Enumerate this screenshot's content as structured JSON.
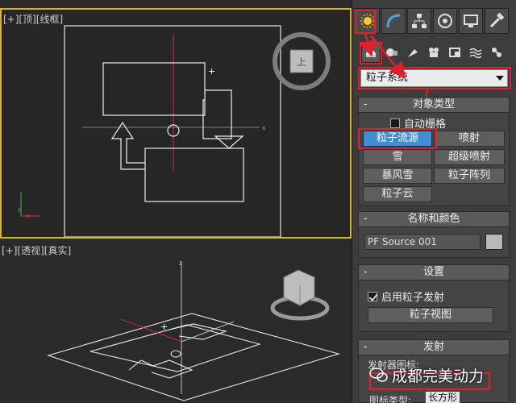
{
  "viewport_top": {
    "label": "[+][顶][线框]"
  },
  "viewport_persp": {
    "label": "[+][透视][真实]",
    "cube_label": "上"
  },
  "command_tabs": [
    "create-icon",
    "modify-icon",
    "hierarchy-icon",
    "motion-icon",
    "display-icon",
    "utilities-icon"
  ],
  "create_categories": [
    "geometry-icon",
    "shapes-icon",
    "lights-icon",
    "cameras-icon",
    "helpers-icon",
    "spacewarps-icon",
    "systems-icon"
  ],
  "dropdown": {
    "value": "粒子系统"
  },
  "object_type": {
    "header": "对象类型",
    "autogrid": "自动栅格",
    "buttons": [
      "粒子流源",
      "喷射",
      "雪",
      "超级喷射",
      "暴风雪",
      "粒子阵列",
      "粒子云"
    ]
  },
  "name_color": {
    "header": "名称和颜色",
    "name": "PF Source 001"
  },
  "setup": {
    "header": "设置",
    "enable": "启用粒子发射",
    "view_button": "粒子视图"
  },
  "emission": {
    "header": "发射",
    "icon_label": "发射器图标:",
    "icon_type_label": "图标类型:",
    "icon_type_value": "长方形"
  },
  "watermark": "成都完美动力",
  "colors": {
    "highlight": "#e0202a",
    "active_button": "#3f8fd6",
    "viewport_border": "#d6b23a"
  }
}
